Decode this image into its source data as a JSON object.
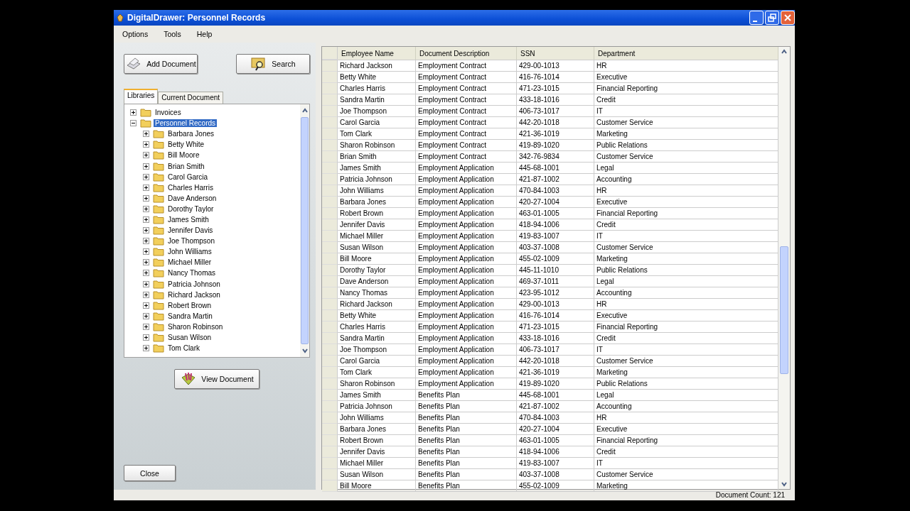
{
  "window": {
    "title": "DigitalDrawer: Personnel Records"
  },
  "menu": [
    "Options",
    "Tools",
    "Help"
  ],
  "toolbar": [
    "Add Document",
    "Search"
  ],
  "tabs": [
    {
      "label": "Libraries",
      "selected": true
    },
    {
      "label": "Current Document",
      "selected": false
    }
  ],
  "tree": [
    {
      "label": "Invoices",
      "expanded": false,
      "selected": false
    },
    {
      "label": "Personnel Records",
      "expanded": true,
      "selected": true,
      "children": [
        {
          "label": "Barbara Jones",
          "expanded": false,
          "selected": false
        },
        {
          "label": "Betty White",
          "expanded": false,
          "selected": false
        },
        {
          "label": "Bill Moore",
          "expanded": false,
          "selected": false
        },
        {
          "label": "Brian Smith",
          "expanded": false,
          "selected": false
        },
        {
          "label": "Carol Garcia",
          "expanded": false,
          "selected": false
        },
        {
          "label": "Charles Harris",
          "expanded": false,
          "selected": false
        },
        {
          "label": "Dave Anderson",
          "expanded": false,
          "selected": false
        },
        {
          "label": "Dorothy Taylor",
          "expanded": false,
          "selected": false
        },
        {
          "label": "James Smith",
          "expanded": false,
          "selected": false
        },
        {
          "label": "Jennifer Davis",
          "expanded": false,
          "selected": false
        },
        {
          "label": "Joe Thompson",
          "expanded": false,
          "selected": false
        },
        {
          "label": "John Williams",
          "expanded": false,
          "selected": false
        },
        {
          "label": "Michael Miller",
          "expanded": false,
          "selected": false
        },
        {
          "label": "Nancy Thomas",
          "expanded": false,
          "selected": false
        },
        {
          "label": "Patricia Johnson",
          "expanded": false,
          "selected": false
        },
        {
          "label": "Richard Jackson",
          "expanded": false,
          "selected": false
        },
        {
          "label": "Robert Brown",
          "expanded": false,
          "selected": false
        },
        {
          "label": "Sandra Martin",
          "expanded": false,
          "selected": false
        },
        {
          "label": "Sharon Robinson",
          "expanded": false,
          "selected": false
        },
        {
          "label": "Susan Wilson",
          "expanded": false,
          "selected": false
        },
        {
          "label": "Tom Clark",
          "expanded": false,
          "selected": false
        }
      ]
    }
  ],
  "view_button": "View Document",
  "close_button": "Close",
  "table": {
    "columns": [
      "Employee Name",
      "Document Description",
      "SSN",
      "Department"
    ],
    "rows": [
      [
        "Richard Jackson",
        "Employment Contract",
        "429-00-1013",
        "HR"
      ],
      [
        "Betty White",
        "Employment Contract",
        "416-76-1014",
        "Executive"
      ],
      [
        "Charles Harris",
        "Employment Contract",
        "471-23-1015",
        "Financial Reporting"
      ],
      [
        "Sandra Martin",
        "Employment Contract",
        "433-18-1016",
        "Credit"
      ],
      [
        "Joe Thompson",
        "Employment Contract",
        "406-73-1017",
        "IT"
      ],
      [
        "Carol Garcia",
        "Employment Contract",
        "442-20-1018",
        "Customer Service"
      ],
      [
        "Tom Clark",
        "Employment Contract",
        "421-36-1019",
        "Marketing"
      ],
      [
        "Sharon Robinson",
        "Employment Contract",
        "419-89-1020",
        "Public Relations"
      ],
      [
        "Brian Smith",
        "Employment Contract",
        "342-76-9834",
        "Customer Service"
      ],
      [
        "James Smith",
        "Employment Application",
        "445-68-1001",
        "Legal"
      ],
      [
        "Patricia Johnson",
        "Employment Application",
        "421-87-1002",
        "Accounting"
      ],
      [
        "John Williams",
        "Employment Application",
        "470-84-1003",
        "HR"
      ],
      [
        "Barbara Jones",
        "Employment Application",
        "420-27-1004",
        "Executive"
      ],
      [
        "Robert Brown",
        "Employment Application",
        "463-01-1005",
        "Financial Reporting"
      ],
      [
        "Jennifer Davis",
        "Employment Application",
        "418-94-1006",
        "Credit"
      ],
      [
        "Michael Miller",
        "Employment Application",
        "419-83-1007",
        "IT"
      ],
      [
        "Susan Wilson",
        "Employment Application",
        "403-37-1008",
        "Customer Service"
      ],
      [
        "Bill Moore",
        "Employment Application",
        "455-02-1009",
        "Marketing"
      ],
      [
        "Dorothy Taylor",
        "Employment Application",
        "445-11-1010",
        "Public Relations"
      ],
      [
        "Dave Anderson",
        "Employment Application",
        "469-37-1011",
        "Legal"
      ],
      [
        "Nancy Thomas",
        "Employment Application",
        "423-95-1012",
        "Accounting"
      ],
      [
        "Richard Jackson",
        "Employment Application",
        "429-00-1013",
        "HR"
      ],
      [
        "Betty White",
        "Employment Application",
        "416-76-1014",
        "Executive"
      ],
      [
        "Charles Harris",
        "Employment Application",
        "471-23-1015",
        "Financial Reporting"
      ],
      [
        "Sandra Martin",
        "Employment Application",
        "433-18-1016",
        "Credit"
      ],
      [
        "Joe Thompson",
        "Employment Application",
        "406-73-1017",
        "IT"
      ],
      [
        "Carol Garcia",
        "Employment Application",
        "442-20-1018",
        "Customer Service"
      ],
      [
        "Tom Clark",
        "Employment Application",
        "421-36-1019",
        "Marketing"
      ],
      [
        "Sharon Robinson",
        "Employment Application",
        "419-89-1020",
        "Public Relations"
      ],
      [
        "James Smith",
        "Benefits Plan",
        "445-68-1001",
        "Legal"
      ],
      [
        "Patricia Johnson",
        "Benefits Plan",
        "421-87-1002",
        "Accounting"
      ],
      [
        "John Williams",
        "Benefits Plan",
        "470-84-1003",
        "HR"
      ],
      [
        "Barbara Jones",
        "Benefits Plan",
        "420-27-1004",
        "Executive"
      ],
      [
        "Robert Brown",
        "Benefits Plan",
        "463-01-1005",
        "Financial Reporting"
      ],
      [
        "Jennifer Davis",
        "Benefits Plan",
        "418-94-1006",
        "Credit"
      ],
      [
        "Michael Miller",
        "Benefits Plan",
        "419-83-1007",
        "IT"
      ],
      [
        "Susan Wilson",
        "Benefits Plan",
        "403-37-1008",
        "Customer Service"
      ],
      [
        "Bill Moore",
        "Benefits Plan",
        "455-02-1009",
        "Marketing"
      ]
    ]
  },
  "status_bar": "Document Count: 121"
}
